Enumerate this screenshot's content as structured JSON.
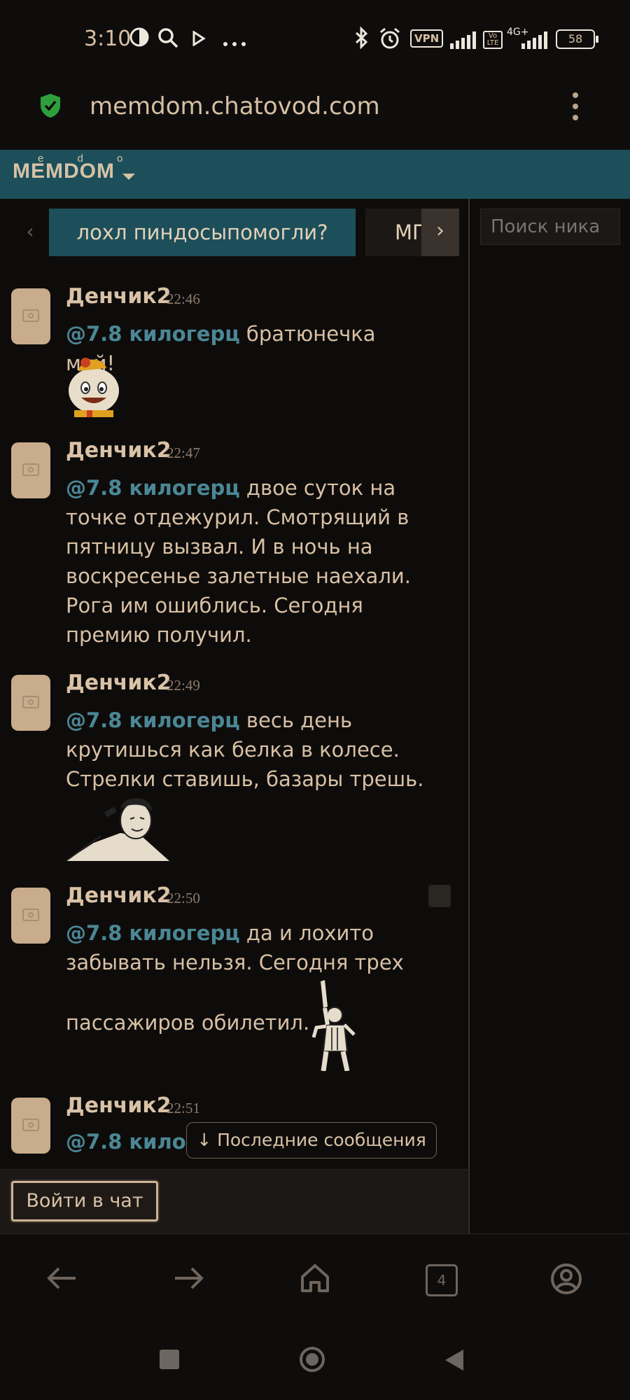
{
  "status_bar": {
    "time": "3:10",
    "vpn_label": "VPN",
    "volte_label": "Vo LTE",
    "network_label": "4G+",
    "battery": "58"
  },
  "browser": {
    "url": "memdom.chatovod.com",
    "tab_count": "4"
  },
  "app": {
    "brand": "MEMDOM",
    "brand_superscript": "e d o",
    "tabs": [
      "лохл пиндосыпомогли?",
      "МГ"
    ],
    "nick_search_placeholder": "Поиск ника"
  },
  "messages": [
    {
      "author": "Денчик2",
      "time": "22:46",
      "mention": "@7.8 килогерц",
      "text": " братюнечка мой!",
      "sticker": "cartoon-face-sticker"
    },
    {
      "author": "Денчик2",
      "time": "22:47",
      "mention": "@7.8 килогерц",
      "text": " двое суток на точке отдежурил. Смотрящий в пятницу вызвал. И в ночь на воскресенье залетные наехали. Рога им ошиблись. Сегодня премию получил."
    },
    {
      "author": "Денчик2",
      "time": "22:49",
      "mention": "@7.8 килогерц",
      "text": " весь день крутишься как белка в колесе. Стрелки ставишь, базары трешь.",
      "sticker": "singer-meme-sticker"
    },
    {
      "author": "Денчик2",
      "time": "22:50",
      "mention": "@7.8 килогерц",
      "text_line1": " да и лохито",
      "text_line2": "забывать нельзя. Сегодня трех",
      "text_line3": "пассажиров обилетил.",
      "sticker": "freddie-pose-sticker"
    },
    {
      "author": "Денчик2",
      "time": "22:51",
      "mention": "@7.8 килог"
    }
  ],
  "latest_messages_label": "↓ Последние сообщения",
  "login_button": "Войти в чат"
}
